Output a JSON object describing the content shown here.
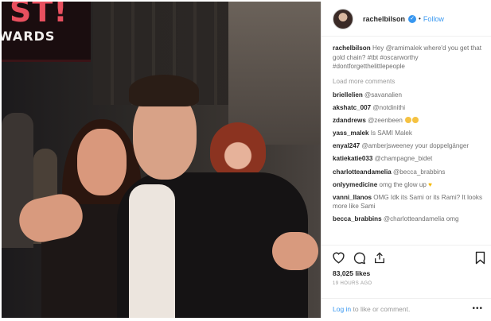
{
  "photo": {
    "marquee_big": "ST!",
    "marquee_small": "WARDS"
  },
  "header": {
    "username": "rachelbilson",
    "verified_icon": "check",
    "separator": "•",
    "follow_label": "Follow"
  },
  "caption": {
    "user": "rachelbilson",
    "text": "Hey @ramimalek where'd you get that gold chain? #tbt #oscarworthy #dontforgetthelittlepeople"
  },
  "load_more_label": "Load more comments",
  "comments": [
    {
      "user": "briellelien",
      "text": "@savanalien"
    },
    {
      "user": "akshatc_007",
      "text": "@notdinithi"
    },
    {
      "user": "zdandrews",
      "text": "@zeenbeen"
    },
    {
      "user": "yass_malek",
      "text": "Is SAMI Malek"
    },
    {
      "user": "enyal247",
      "text": "@amberjsweeney your doppelgänger"
    },
    {
      "user": "katiekatie033",
      "text": "@champagne_bidet"
    },
    {
      "user": "charlotteandamelia",
      "text": "@becca_brabbins"
    },
    {
      "user": "onlyymedicine",
      "text": "omg the glow up"
    },
    {
      "user": "vanni_llanos",
      "text": "OMG Idk its Sami or its Rami? It looks more like Sami"
    },
    {
      "user": "becca_brabbins",
      "text": "@charlotteandamelia omg"
    }
  ],
  "actions": {
    "like_icon": "heart-outline",
    "comment_icon": "speech-bubble",
    "share_icon": "share-arrow",
    "save_icon": "bookmark"
  },
  "likes": "83,025 likes",
  "time": "19 HOURS AGO",
  "login": {
    "link_label": "Log in",
    "suffix": "to like or comment.",
    "more_label": "•••"
  },
  "colors": {
    "link_blue": "#3897f0",
    "text_dark": "#262626",
    "text_muted": "#999999"
  }
}
